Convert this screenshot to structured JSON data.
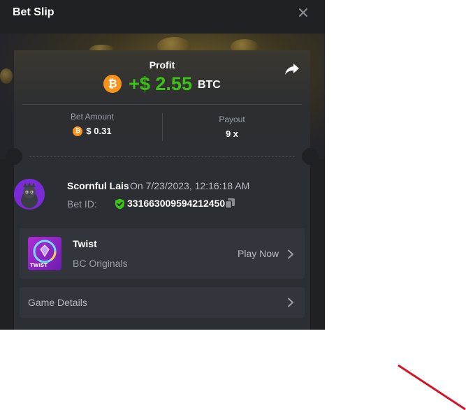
{
  "modal": {
    "title": "Bet Slip",
    "close_icon": "close-icon"
  },
  "profit": {
    "label": "Profit",
    "value": "+$ 2.55",
    "currency": "BTC",
    "coin_symbol": "₿",
    "share_icon": "share-icon"
  },
  "stats": {
    "bet_amount_label": "Bet Amount",
    "bet_amount_value": "$ 0.31",
    "payout_label": "Payout",
    "payout_value": "9 x"
  },
  "user": {
    "name": "Scornful Lais",
    "date": "On 7/23/2023, 12:16:18 AM",
    "bet_id_label": "Bet ID:",
    "bet_id": "331663009594212450"
  },
  "game": {
    "name": "Twist",
    "provider": "BC Originals",
    "thumb_label": "TWIST",
    "play_label": "Play Now"
  },
  "details": {
    "label": "Game Details"
  },
  "colors": {
    "accent_green": "#3bc117",
    "btc_orange": "#f7931a",
    "panel": "#1f2125",
    "card": "#2b2e33",
    "annotation_red": "#d4142a"
  }
}
